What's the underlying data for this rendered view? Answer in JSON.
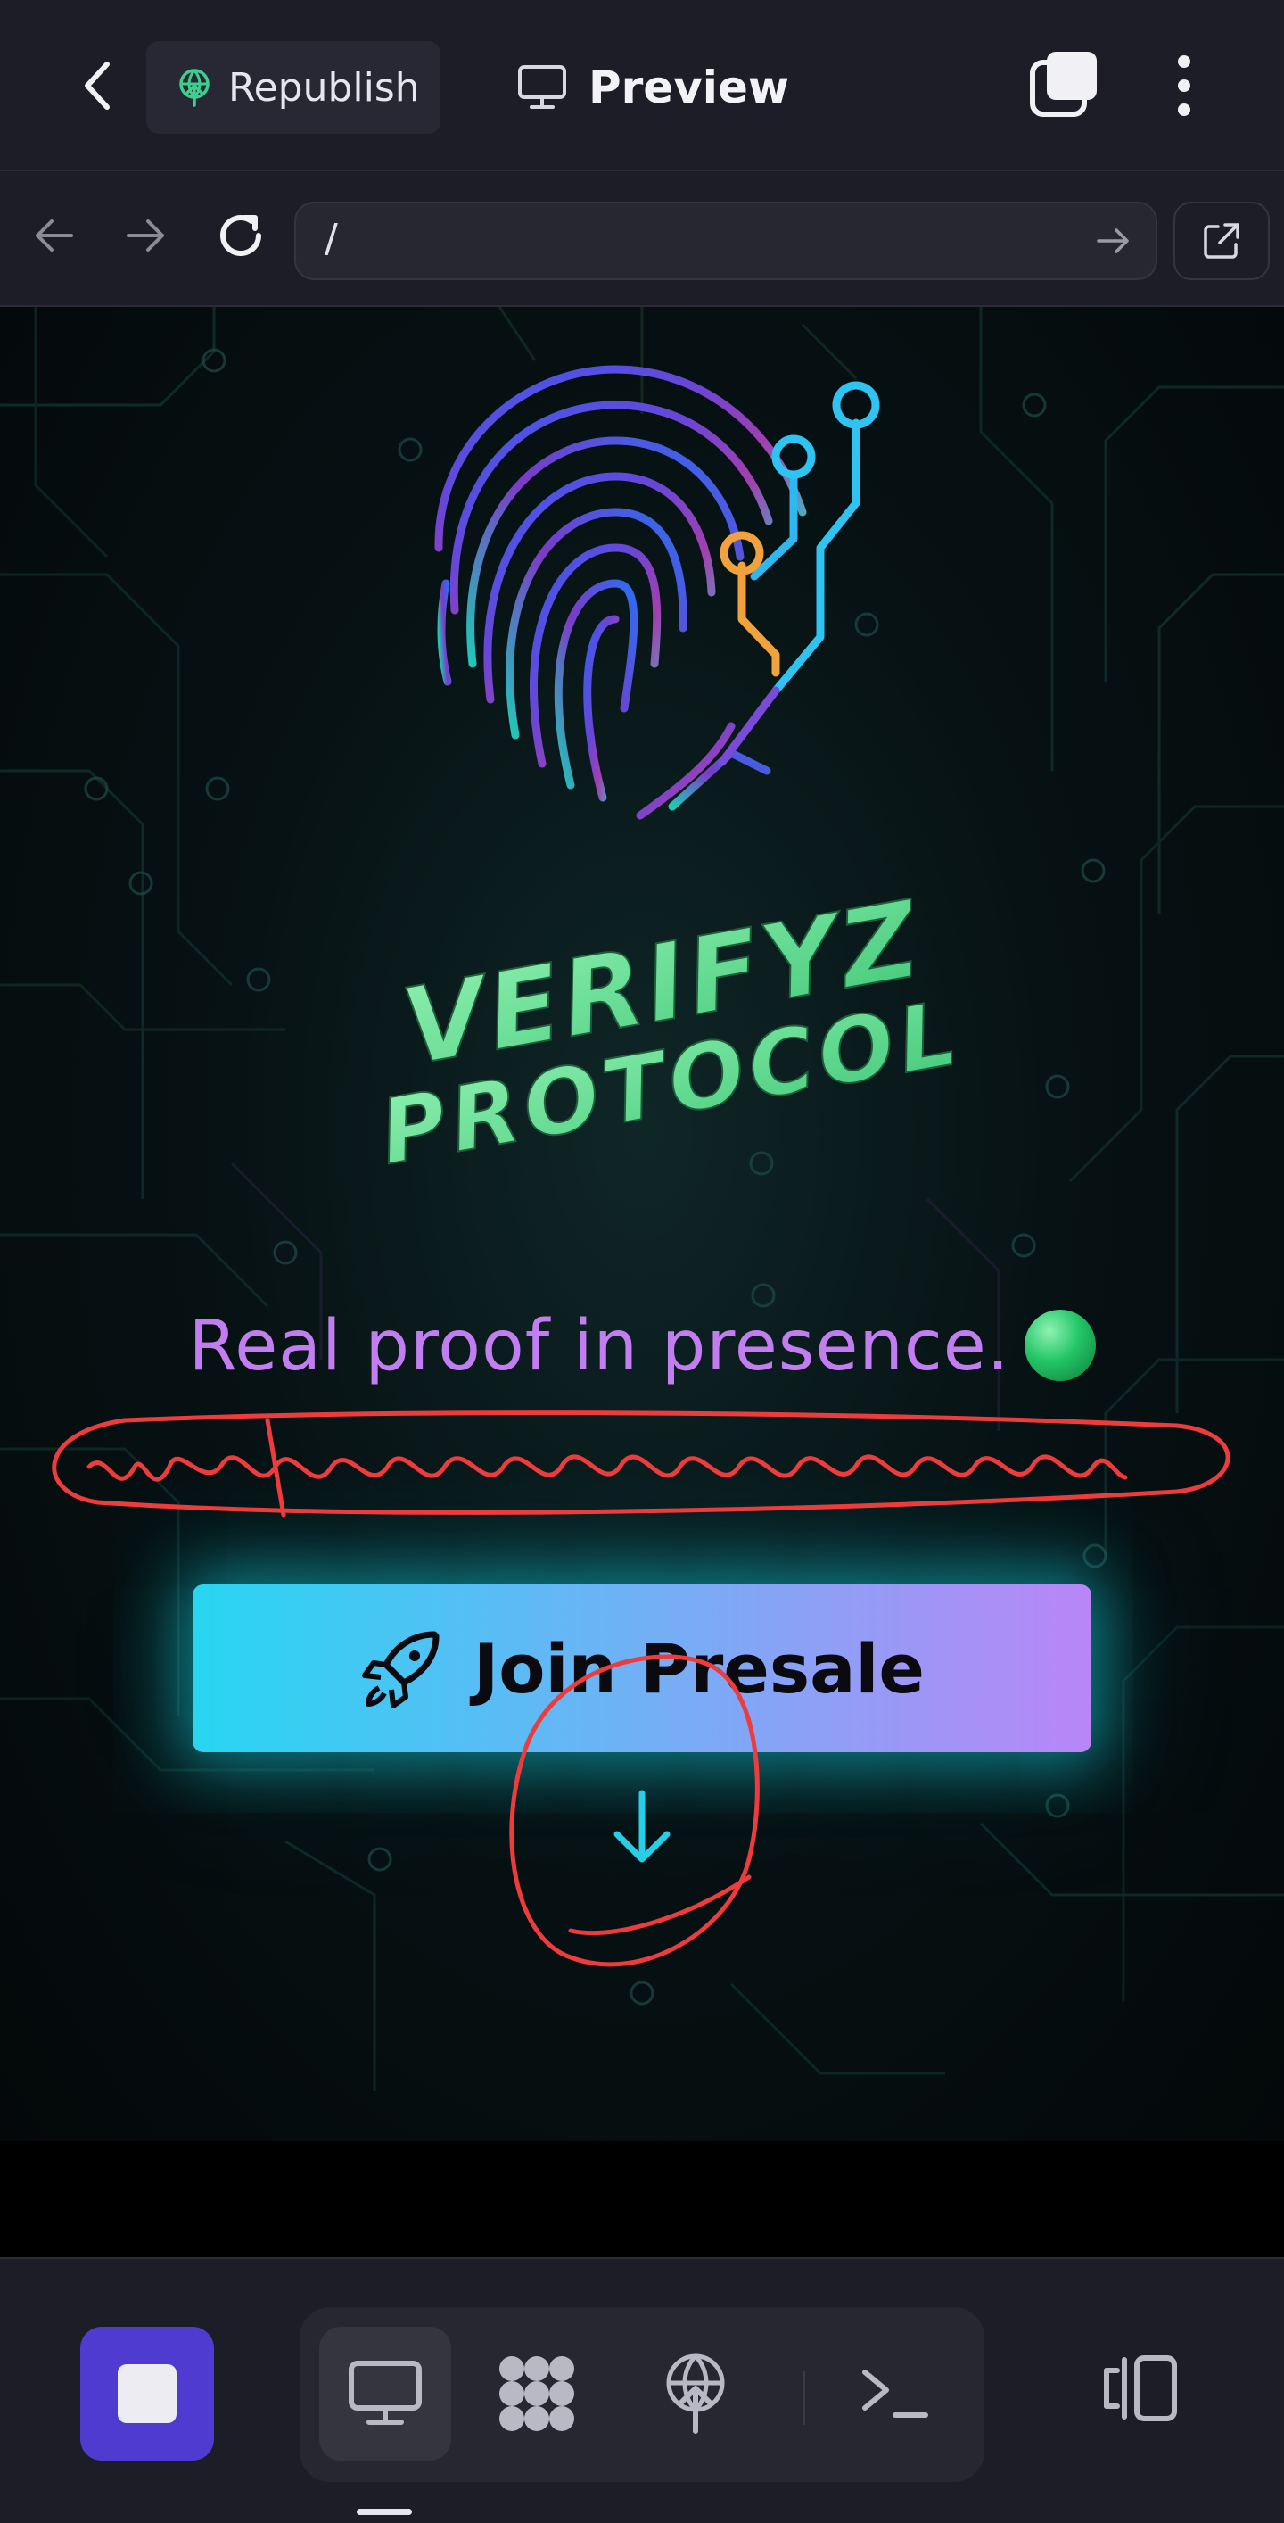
{
  "topbar": {
    "back_icon": "chevron-left-icon",
    "republish_label": "Republish",
    "republish_icon": "publish-icon",
    "preview_label": "Preview",
    "preview_icon": "monitor-icon",
    "tabs_icon": "tabs-icon",
    "menu_icon": "more-vertical-icon"
  },
  "browser": {
    "back_icon": "arrow-left-icon",
    "forward_icon": "arrow-right-icon",
    "reload_icon": "reload-icon",
    "url": "/",
    "go_icon": "arrow-right-icon",
    "external_icon": "external-link-icon"
  },
  "site": {
    "logo_icon": "fingerprint-circuit-icon",
    "brand_line1": "VERIFYZ",
    "brand_line2": "PROTOCOL",
    "tagline": "Real proof in presence.",
    "tagline_emoji": "green-circle-icon",
    "cta_label": "Join Presale",
    "cta_icon": "rocket-icon",
    "scroll_icon": "arrow-down-icon",
    "colors": {
      "accent_cyan": "#27d6f1",
      "accent_purple": "#b986f7",
      "tagline": "#c27ef0",
      "brand_green": "#6fe39b",
      "annotation_red": "#ee3b3b"
    }
  },
  "bottombar": {
    "stop_icon": "stop-icon",
    "tools": [
      "monitor-icon",
      "apps-grid-icon",
      "publish-icon",
      "terminal-icon"
    ],
    "active_tool": "monitor-icon",
    "layout_icon": "split-layout-icon",
    "colors": {
      "stop_bg": "#4f3bd0"
    }
  }
}
